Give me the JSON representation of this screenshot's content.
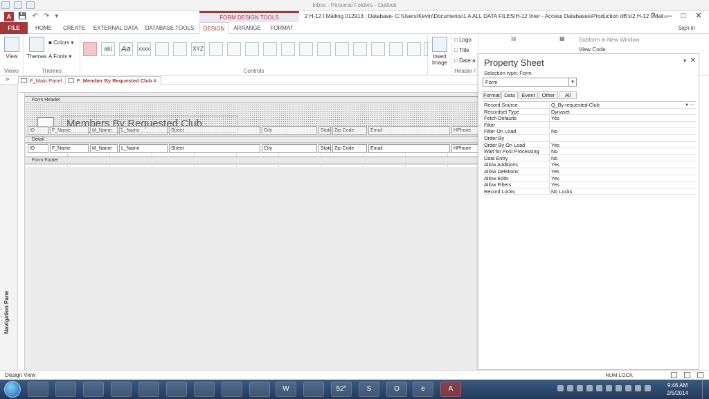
{
  "outlook": {
    "title": "Inbox - Personal Folders - Outlook"
  },
  "window": {
    "context_label": "FORM DESIGN TOOLS",
    "doc_title": "2   H-12 I Mailing 012913 : Database- C:\\Users\\Kevin\\Documents\\1 A ALL DATA FILES\\H-12 Inter - Access Databases\\Production dB's\\2   H-12 I Mail...",
    "help": "?",
    "minimize": "—",
    "restore": "□",
    "close": "✕"
  },
  "app_icon": "A",
  "tabs": [
    {
      "label": "FILE"
    },
    {
      "label": "HOME"
    },
    {
      "label": "CREATE"
    },
    {
      "label": "EXTERNAL DATA"
    },
    {
      "label": "DATABASE TOOLS"
    },
    {
      "label": "DESIGN"
    },
    {
      "label": "ARRANGE"
    },
    {
      "label": "FORMAT"
    }
  ],
  "sign_in": "Sign in",
  "ribbon": {
    "views": {
      "button": "View",
      "group": "Views"
    },
    "themes": {
      "button": "Themes",
      "colors": "Colors",
      "fonts": "Fonts",
      "group": "Themes"
    },
    "controls": {
      "group": "Controls",
      "items": [
        "",
        "ab|",
        "Aa",
        "xxxx",
        "",
        "",
        "XYZ",
        "",
        "",
        "",
        "",
        "",
        "",
        "",
        "",
        "",
        "",
        "",
        "",
        ""
      ]
    },
    "insert_image": "Insert Image",
    "header_footer": {
      "logo": "Logo",
      "title": "Title",
      "date": "Date a",
      "group": "Header /"
    },
    "tools": {
      "subform": "Subform in New Window",
      "view_code": "View Code"
    }
  },
  "doc_tabs": [
    {
      "label": "F_Main Panel"
    },
    {
      "label": "F_Member By Requested Club #"
    }
  ],
  "nav_pane": {
    "label": "Navigation Pane",
    "chevron": "»"
  },
  "form": {
    "sections": {
      "header": "Form Header",
      "detail": "Detail",
      "footer": "Form Footer"
    },
    "title": "Members By Requested Club",
    "header_labels": [
      "ID",
      "F_Name",
      "M_Name",
      "L_Name",
      "Street",
      "City",
      "State",
      "Zip Code",
      "Email",
      "HPhone"
    ],
    "detail_fields": [
      "ID",
      "F_Name",
      "M_Name",
      "L_Name",
      "Street",
      "City",
      "State",
      "Zip Code",
      "Email",
      "HPhone"
    ]
  },
  "property_sheet": {
    "title": "Property Sheet",
    "selection_type": "Selection type:  Form",
    "selector": "Form",
    "tabs": [
      "Format",
      "Data",
      "Event",
      "Other",
      "All"
    ],
    "rows": [
      {
        "name": "Record Source",
        "value": "Q_By requested Club"
      },
      {
        "name": "Recordset Type",
        "value": "Dynaset"
      },
      {
        "name": "Fetch Defaults",
        "value": "Yes"
      },
      {
        "name": "Filter",
        "value": ""
      },
      {
        "name": "Filter On Load",
        "value": "No"
      },
      {
        "name": "Order By",
        "value": ""
      },
      {
        "name": "Order By On Load",
        "value": "Yes"
      },
      {
        "name": "Wait for Post Processing",
        "value": "No"
      },
      {
        "name": "Data Entry",
        "value": "No"
      },
      {
        "name": "Allow Additions",
        "value": "Yes"
      },
      {
        "name": "Allow Deletions",
        "value": "Yes"
      },
      {
        "name": "Allow Edits",
        "value": "Yes"
      },
      {
        "name": "Allow Filters",
        "value": "Yes"
      },
      {
        "name": "Record Locks",
        "value": "No Locks"
      }
    ]
  },
  "status": {
    "left": "Design View",
    "num_lock": "NUM LOCK"
  },
  "taskbar": {
    "clock_time": "9:46 AM",
    "clock_date": "2/5/2014",
    "items": [
      "",
      "",
      "",
      "",
      "",
      "",
      "",
      "",
      "",
      "W",
      "",
      "52°",
      "S",
      "O",
      "e",
      "A"
    ]
  },
  "colors": {
    "accent": "#a4373a",
    "taskbar": "#2c4669"
  }
}
